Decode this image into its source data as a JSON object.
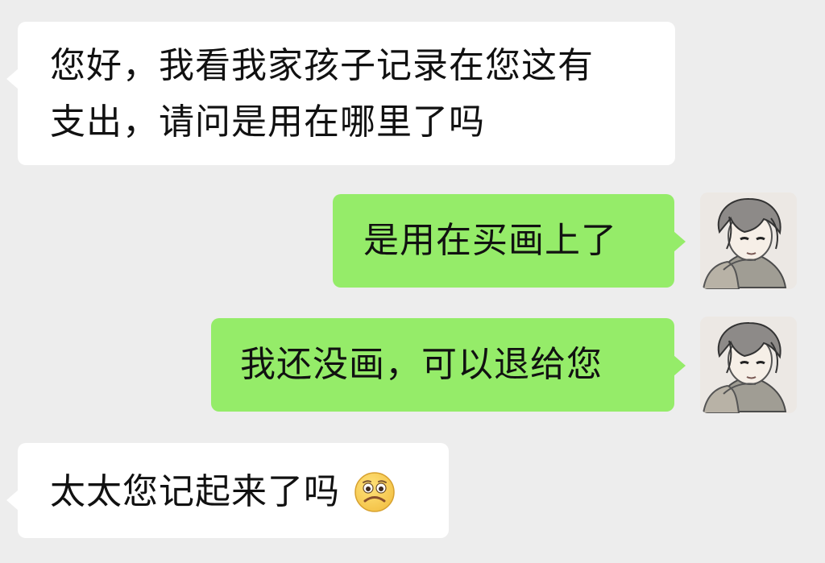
{
  "messages": [
    {
      "sender": "other",
      "lines": [
        "您好，我看我家孩子记录在您这有",
        "支出，请问是用在哪里了吗"
      ]
    },
    {
      "sender": "self",
      "text": "是用在买画上了"
    },
    {
      "sender": "self",
      "text": "我还没画，可以退给您"
    },
    {
      "sender": "other",
      "text": "太太您记起来了吗",
      "emoji": "frowning-face-emoji"
    }
  ],
  "colors": {
    "background": "#ededed",
    "incoming_bubble": "#ffffff",
    "outgoing_bubble": "#95ec69",
    "text": "#111111"
  },
  "icons": {
    "avatar": "sketch-avatar-icon",
    "emoji": "frowning-face-emoji"
  }
}
